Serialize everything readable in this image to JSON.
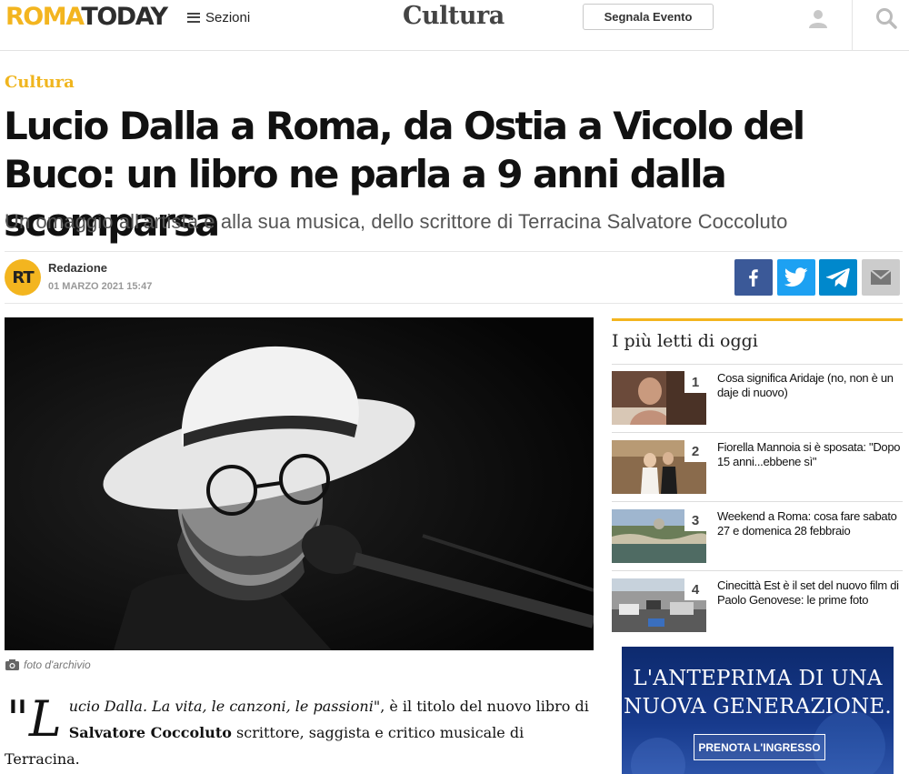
{
  "header": {
    "logo_roma": "ROMA",
    "logo_today": "TODAY",
    "sezioni_label": "Sezioni",
    "section_title": "Cultura",
    "segnala_label": "Segnala Evento"
  },
  "article": {
    "kicker": "Cultura",
    "title": "Lucio Dalla a Roma, da Ostia a Vicolo del Buco: un libro ne parla a 9 anni dalla scomparsa",
    "subtitle": "Un omaggio all'artista e alla sua musica, dello scrittore di Terracina Salvatore Coccoluto",
    "author_initials": "RT",
    "author": "Redazione",
    "date": "01 MARZO 2021 15:47",
    "image_caption": "foto d'archivio",
    "body": {
      "dropcap": "\"L",
      "italic": "ucio Dalla. La vita, le canzoni, le passioni\"",
      "text1": ", è il titolo del nuovo libro di ",
      "bold": "Salvatore Coccoluto",
      "text2": " scrittore, saggista e critico musicale di Terracina."
    }
  },
  "share": {
    "facebook_icon": "facebook-icon",
    "twitter_icon": "twitter-icon",
    "telegram_icon": "telegram-icon",
    "email_icon": "email-icon"
  },
  "sidebar": {
    "title": "I più letti di oggi",
    "items": [
      {
        "rank": "1",
        "text": "Cosa significa Aridaje (no, non è un daje di nuovo)"
      },
      {
        "rank": "2",
        "text": "Fiorella Mannoia si è sposata: \"Dopo 15 anni...ebbene sì\""
      },
      {
        "rank": "3",
        "text": "Weekend a Roma: cosa fare sabato 27 e domenica 28 febbraio"
      },
      {
        "rank": "4",
        "text": "Cinecittà Est è il set del nuovo film di Paolo Genovese: le prime foto"
      }
    ]
  },
  "ad": {
    "headline_line1": "L'ANTEPRIMA DI UNA",
    "headline_line2": "NUOVA GENERAZIONE.",
    "button": "PRENOTA L'INGRESSO"
  },
  "colors": {
    "brand_yellow": "#f3b51f",
    "facebook": "#3b5998",
    "twitter": "#1da1f2",
    "telegram": "#0088cc",
    "email": "#cccccc"
  }
}
